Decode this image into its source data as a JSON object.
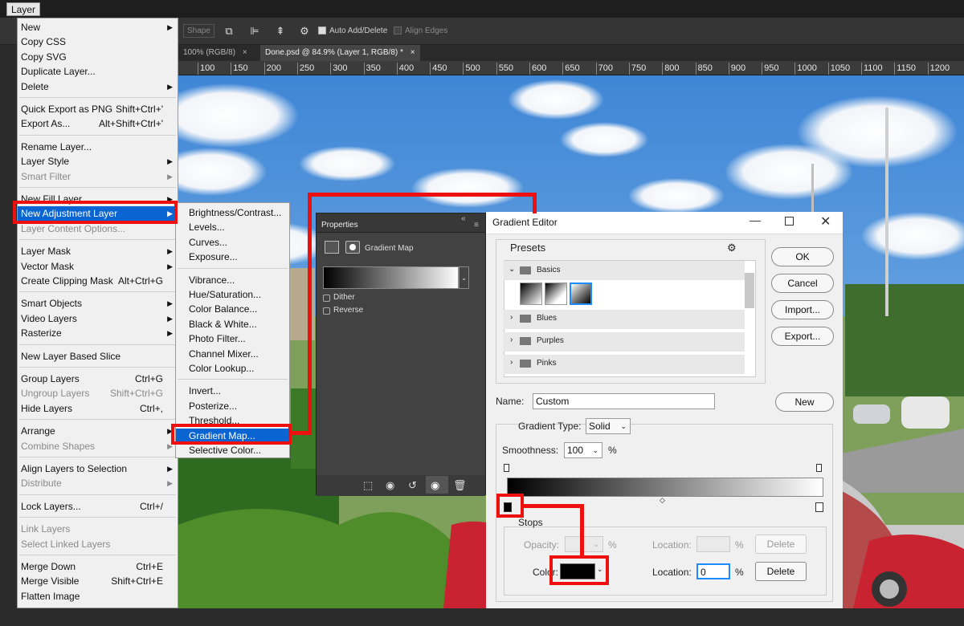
{
  "app": {
    "menu_title": "Layer"
  },
  "options_bar": {
    "shape_label": "Shape",
    "auto_add_delete": "Auto Add/Delete",
    "align_edges": "Align Edges"
  },
  "tabs": [
    {
      "label": "100% (RGB/8)",
      "close": "×"
    },
    {
      "label": "Done.psd @ 84.9% (Layer 1, RGB/8) *",
      "close": "×"
    }
  ],
  "ruler": [
    "100",
    "150",
    "200",
    "250",
    "300",
    "350",
    "400",
    "450",
    "500",
    "550",
    "600",
    "650",
    "700",
    "750",
    "800",
    "850",
    "900",
    "950",
    "1000",
    "1050",
    "1100",
    "1150",
    "1200"
  ],
  "layer_menu": {
    "items": [
      {
        "label": "New",
        "arrow": "▶"
      },
      {
        "label": "Copy CSS"
      },
      {
        "label": "Copy SVG"
      },
      {
        "label": "Duplicate Layer..."
      },
      {
        "label": "Delete",
        "arrow": "▶"
      },
      {
        "label": "Quick Export as PNG",
        "shortcut": "Shift+Ctrl+'"
      },
      {
        "label": "Export As...",
        "shortcut": "Alt+Shift+Ctrl+'"
      },
      {
        "label": "Rename Layer..."
      },
      {
        "label": "Layer Style",
        "arrow": "▶"
      },
      {
        "label": "Smart Filter",
        "arrow": "▶",
        "disabled": true
      },
      {
        "label": "New Fill Layer",
        "arrow": "▶"
      },
      {
        "label": "New Adjustment Layer",
        "arrow": "▶",
        "highlight": true
      },
      {
        "label": "Layer Content Options...",
        "disabled": true
      },
      {
        "label": "Layer Mask",
        "arrow": "▶"
      },
      {
        "label": "Vector Mask",
        "arrow": "▶"
      },
      {
        "label": "Create Clipping Mask",
        "shortcut": "Alt+Ctrl+G"
      },
      {
        "label": "Smart Objects",
        "arrow": "▶"
      },
      {
        "label": "Video Layers",
        "arrow": "▶"
      },
      {
        "label": "Rasterize",
        "arrow": "▶"
      },
      {
        "label": "New Layer Based Slice"
      },
      {
        "label": "Group Layers",
        "shortcut": "Ctrl+G"
      },
      {
        "label": "Ungroup Layers",
        "shortcut": "Shift+Ctrl+G",
        "disabled": true
      },
      {
        "label": "Hide Layers",
        "shortcut": "Ctrl+,"
      },
      {
        "label": "Arrange",
        "arrow": "▶"
      },
      {
        "label": "Combine Shapes",
        "arrow": "▶",
        "disabled": true
      },
      {
        "label": "Align Layers to Selection",
        "arrow": "▶"
      },
      {
        "label": "Distribute",
        "arrow": "▶",
        "disabled": true
      },
      {
        "label": "Lock Layers...",
        "shortcut": "Ctrl+/"
      },
      {
        "label": "Link Layers",
        "disabled": true
      },
      {
        "label": "Select Linked Layers",
        "disabled": true
      },
      {
        "label": "Merge Down",
        "shortcut": "Ctrl+E"
      },
      {
        "label": "Merge Visible",
        "shortcut": "Shift+Ctrl+E"
      },
      {
        "label": "Flatten Image"
      }
    ]
  },
  "adjust_menu": {
    "items": [
      "Brightness/Contrast...",
      "Levels...",
      "Curves...",
      "Exposure...",
      "Vibrance...",
      "Hue/Saturation...",
      "Color Balance...",
      "Black & White...",
      "Photo Filter...",
      "Channel Mixer...",
      "Color Lookup...",
      "Invert...",
      "Posterize...",
      "Threshold...",
      "Gradient Map...",
      "Selective Color..."
    ]
  },
  "properties": {
    "title": "Properties",
    "subtitle": "Gradient Map",
    "dither": "Dither",
    "reverse": "Reverse",
    "collapse": "«",
    "menu": "≡"
  },
  "gradient_editor": {
    "title": "Gradient Editor",
    "presets_label": "Presets",
    "folders": [
      "Basics",
      "Blues",
      "Purples",
      "Pinks"
    ],
    "ok": "OK",
    "cancel": "Cancel",
    "import": "Import...",
    "export": "Export...",
    "name_label": "Name:",
    "name_value": "Custom",
    "new": "New",
    "type_label": "Gradient Type:",
    "type_value": "Solid",
    "smooth_label": "Smoothness:",
    "smooth_value": "100",
    "percent": "%",
    "stops_label": "Stops",
    "opacity_label": "Opacity:",
    "location_label": "Location:",
    "color_label": "Color:",
    "location_value": "0",
    "delete": "Delete"
  },
  "colors": {
    "accent": "#0a64d2",
    "highlight": "#ee0f0f"
  }
}
